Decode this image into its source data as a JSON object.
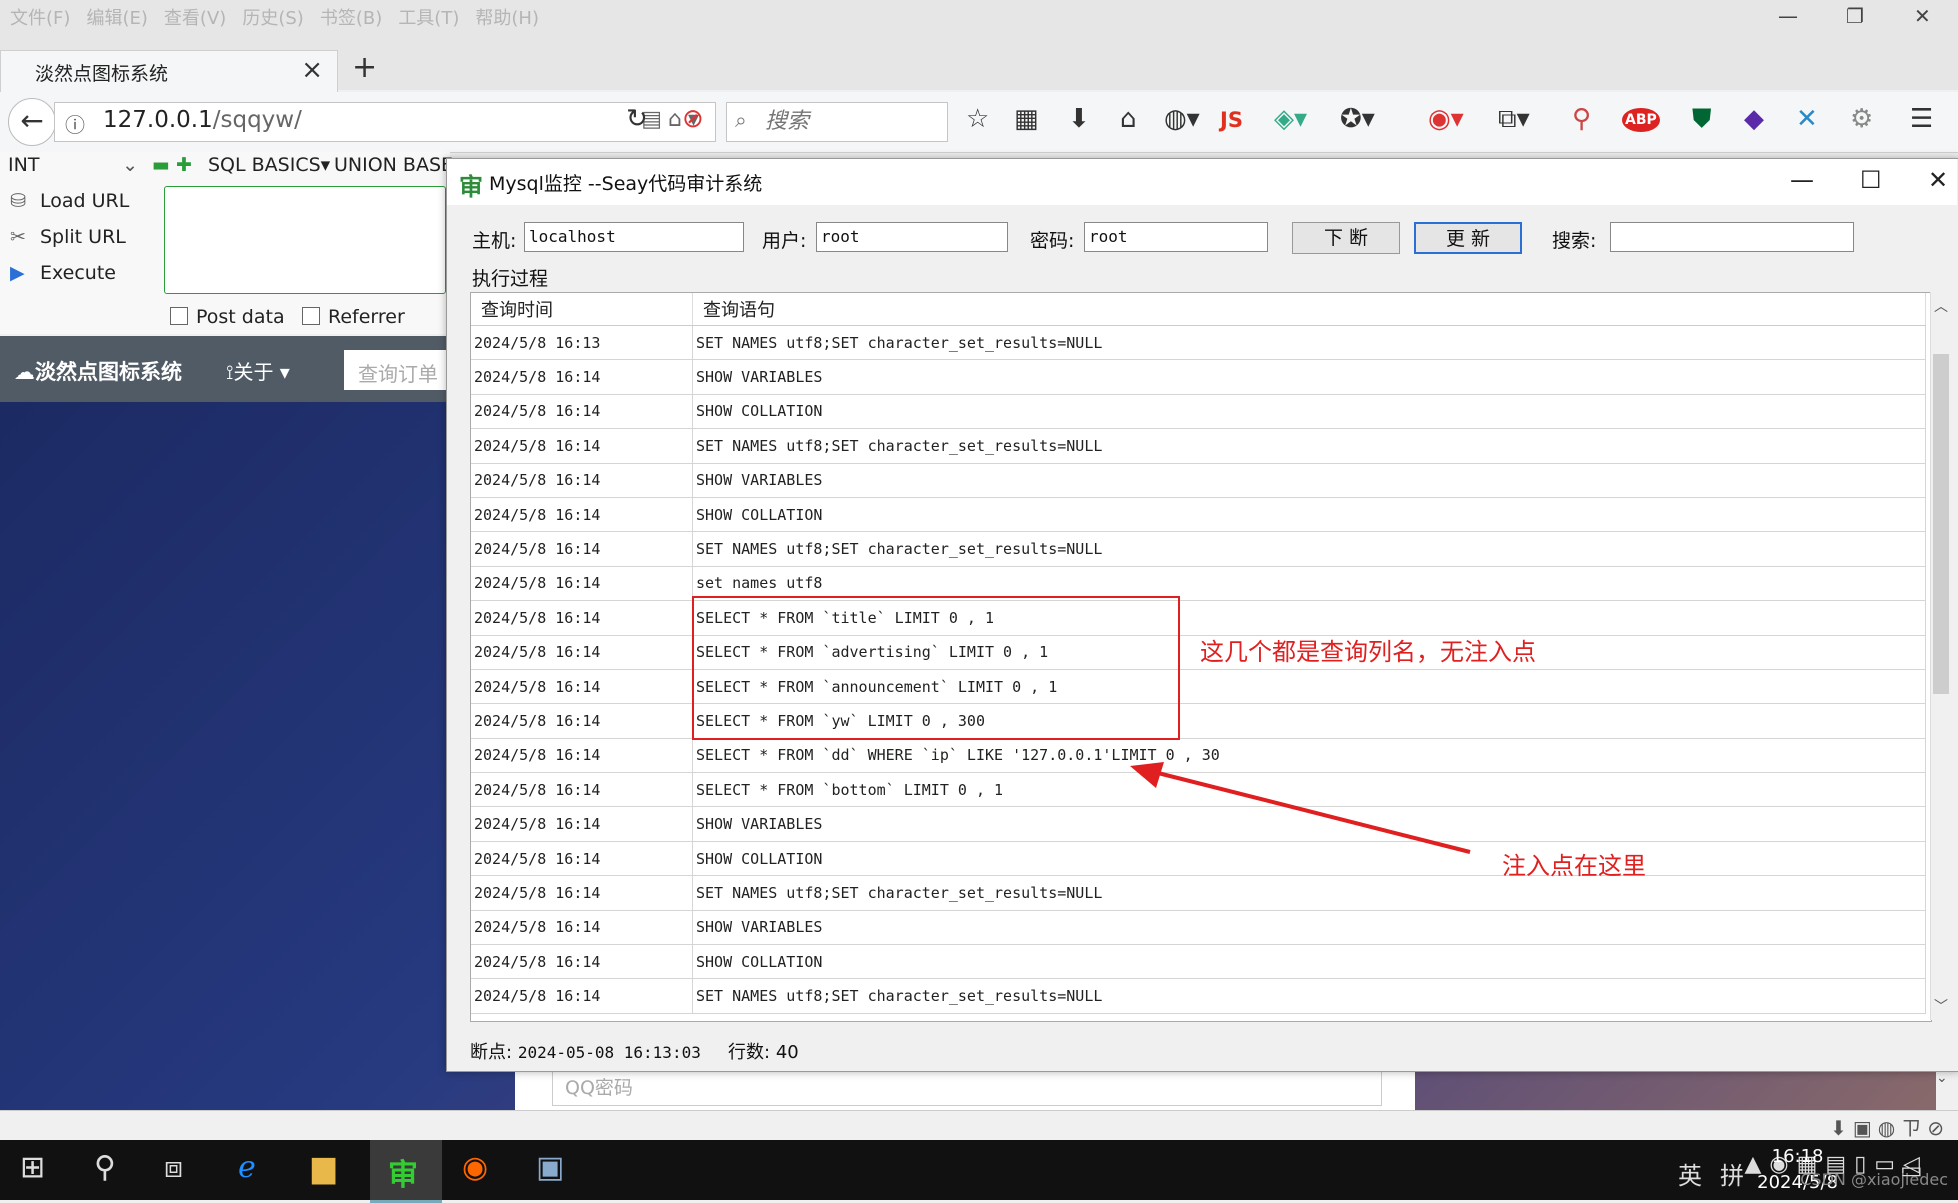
{
  "browser": {
    "menu": [
      "文件(F)",
      "编辑(E)",
      "查看(V)",
      "历史(S)",
      "书签(B)",
      "工具(T)",
      "帮助(H)"
    ],
    "tab_title": "淡然点图标系统",
    "url_host": "127.0.0.1",
    "url_path": "/sqqyw/",
    "search_placeholder": "搜索",
    "js_badge": "JS",
    "abp_badge": "ABP"
  },
  "hackbar": {
    "select_value": "INT",
    "menu": [
      "SQL BASICS",
      "UNION BASE"
    ],
    "actions": [
      "Load URL",
      "Split URL",
      "Execute"
    ],
    "post_data": "Post data",
    "referrer": "Referrer"
  },
  "site": {
    "brand": "淡然点图标系统",
    "about": "关于",
    "search_placeholder": "查询订单",
    "qq_placeholder": "QQ密码"
  },
  "dialog": {
    "title": "Mysql监控 --Seay代码审计系统",
    "host_label": "主机:",
    "host_value": "localhost",
    "user_label": "用户:",
    "user_value": "root",
    "pass_label": "密码:",
    "pass_value": "root",
    "break_button": "下 断",
    "update_button": "更 新",
    "search_label": "搜索:",
    "search_value": "",
    "group_label": "执行过程",
    "columns": [
      "查询时间",
      "查询语句"
    ],
    "rows": [
      [
        "2024/5/8 16:13",
        "SET NAMES utf8;SET character_set_results=NULL"
      ],
      [
        "2024/5/8 16:14",
        "SHOW VARIABLES"
      ],
      [
        "2024/5/8 16:14",
        "SHOW COLLATION"
      ],
      [
        "2024/5/8 16:14",
        "SET NAMES utf8;SET character_set_results=NULL"
      ],
      [
        "2024/5/8 16:14",
        "SHOW VARIABLES"
      ],
      [
        "2024/5/8 16:14",
        "SHOW COLLATION"
      ],
      [
        "2024/5/8 16:14",
        "SET NAMES utf8;SET character_set_results=NULL"
      ],
      [
        "2024/5/8 16:14",
        "set names utf8"
      ],
      [
        "2024/5/8 16:14",
        "SELECT * FROM  `title` LIMIT 0 , 1"
      ],
      [
        "2024/5/8 16:14",
        "SELECT * FROM  `advertising` LIMIT 0 , 1"
      ],
      [
        "2024/5/8 16:14",
        "SELECT * FROM  `announcement` LIMIT 0 , 1"
      ],
      [
        "2024/5/8 16:14",
        "SELECT * FROM  `yw` LIMIT 0 , 300"
      ],
      [
        "2024/5/8 16:14",
        "SELECT * FROM  `dd` WHERE  `ip` LIKE  '127.0.0.1'LIMIT 0 , 30"
      ],
      [
        "2024/5/8 16:14",
        "SELECT * FROM  `bottom` LIMIT 0 , 1"
      ],
      [
        "2024/5/8 16:14",
        "SHOW VARIABLES"
      ],
      [
        "2024/5/8 16:14",
        "SHOW COLLATION"
      ],
      [
        "2024/5/8 16:14",
        "SET NAMES utf8;SET character_set_results=NULL"
      ],
      [
        "2024/5/8 16:14",
        "SHOW VARIABLES"
      ],
      [
        "2024/5/8 16:14",
        "SHOW COLLATION"
      ],
      [
        "2024/5/8 16:14",
        "SET NAMES utf8;SET character_set_results=NULL"
      ]
    ],
    "status_break_label": "断点:",
    "status_break_value": "2024-05-08 16:13:03",
    "status_rows_label": "行数:",
    "status_rows_value": "40"
  },
  "annotations": {
    "box_note": "这几个都是查询列名，无注入点",
    "arrow_note": "注入点在这里"
  },
  "taskbar": {
    "ime": "英",
    "time": "16:18",
    "date": "2024/5/8",
    "watermark": "CSDN @xiaojiedec"
  },
  "colors": {
    "annotation": "#e02020",
    "site_nav": "#515b66",
    "update_border": "#2a6fd6"
  }
}
